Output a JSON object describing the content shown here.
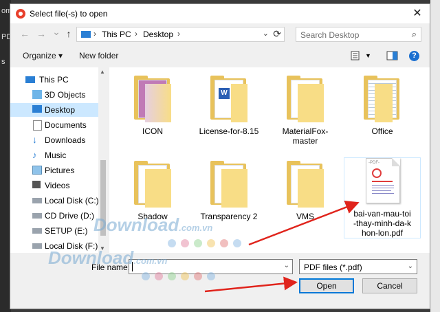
{
  "background_app": {
    "label_1": "om",
    "label_2": "PD",
    "label_3": "s"
  },
  "window": {
    "title": "Select file(-s) to open",
    "close_glyph": "✕"
  },
  "nav": {
    "back_glyph": "←",
    "forward_glyph": "→",
    "recent_glyph": "⌄",
    "up_glyph": "↑",
    "breadcrumbs": [
      "This PC",
      "Desktop"
    ],
    "crumb_sep": "›",
    "search_placeholder": "Search Desktop"
  },
  "toolbar": {
    "organize_label": "Organize ▾",
    "new_folder_label": "New folder",
    "help_glyph": "?"
  },
  "sidebar": {
    "items": [
      {
        "label": "This PC",
        "icon": "pc-icon"
      },
      {
        "label": "3D Objects",
        "icon": "cube-icon"
      },
      {
        "label": "Desktop",
        "icon": "desktop-icon"
      },
      {
        "label": "Documents",
        "icon": "documents-icon"
      },
      {
        "label": "Downloads",
        "icon": "download-arrow-icon"
      },
      {
        "label": "Music",
        "icon": "music-note-icon"
      },
      {
        "label": "Pictures",
        "icon": "pictures-icon"
      },
      {
        "label": "Videos",
        "icon": "videos-icon"
      },
      {
        "label": "Local Disk (C:)",
        "icon": "drive-icon"
      },
      {
        "label": "CD Drive (D:)",
        "icon": "cd-drive-icon"
      },
      {
        "label": "SETUP (E:)",
        "icon": "drive-icon"
      },
      {
        "label": "Local Disk (F:)",
        "icon": "drive-icon"
      }
    ],
    "selected": "Desktop"
  },
  "files": [
    {
      "name": "ICON",
      "type": "folder"
    },
    {
      "name": "License-for-8.15",
      "type": "folder"
    },
    {
      "name": "MaterialFox-master",
      "type": "folder"
    },
    {
      "name": "Office",
      "type": "folder"
    },
    {
      "name": "Shadow",
      "type": "folder"
    },
    {
      "name": "Transparency 2",
      "type": "folder"
    },
    {
      "name": "VMS",
      "type": "folder"
    },
    {
      "name": "bai-van-mau-toi-thay-minh-da-khon-lon.pdf",
      "type": "pdf",
      "name_lines": [
        "bai-van-mau-toi",
        "-thay-minh-da-k",
        "hon-lon.pdf"
      ],
      "pdf_tag": "-PDF-"
    }
  ],
  "bottom": {
    "file_name_label": "File name:",
    "file_name_value": "",
    "file_type_value": "PDF files (*.pdf)",
    "open_label": "Open",
    "cancel_label": "Cancel"
  },
  "watermark": {
    "text_1": "Download",
    "suffix_1": ".com.vn",
    "text_2": "Download",
    "suffix_2": ".com.vn"
  },
  "colors": {
    "accent": "#0078d7",
    "selected_bg": "#cce8ff",
    "folder": "#e8c25b",
    "arrow": "#e0241c",
    "pdf": "#e03b3b"
  }
}
